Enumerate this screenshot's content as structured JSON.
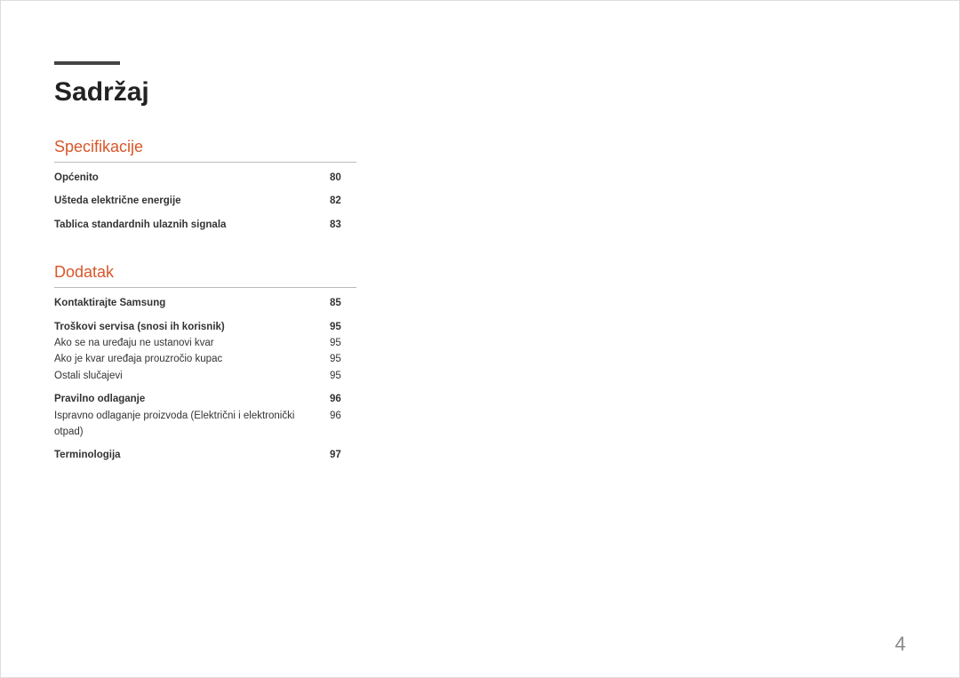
{
  "title": "Sadržaj",
  "page_number": "4",
  "sections": [
    {
      "heading": "Specifikacije",
      "groups": [
        [
          {
            "label": "Općenito",
            "page": "80",
            "bold": true
          }
        ],
        [
          {
            "label": "Ušteda električne energije",
            "page": "82",
            "bold": true
          }
        ],
        [
          {
            "label": "Tablica standardnih ulaznih signala",
            "page": "83",
            "bold": true
          }
        ]
      ]
    },
    {
      "heading": "Dodatak",
      "groups": [
        [
          {
            "label": "Kontaktirajte Samsung",
            "page": "85",
            "bold": true
          }
        ],
        [
          {
            "label": "Troškovi servisa (snosi ih korisnik)",
            "page": "95",
            "bold": true
          },
          {
            "label": "Ako se na uređaju ne ustanovi kvar",
            "page": "95",
            "bold": false
          },
          {
            "label": "Ako je kvar uređaja prouzročio kupac",
            "page": "95",
            "bold": false
          },
          {
            "label": "Ostali slučajevi",
            "page": "95",
            "bold": false
          }
        ],
        [
          {
            "label": "Pravilno odlaganje",
            "page": "96",
            "bold": true
          },
          {
            "label": "Ispravno odlaganje proizvoda (Električni i elektronički otpad)",
            "page": "96",
            "bold": false
          }
        ],
        [
          {
            "label": "Terminologija",
            "page": "97",
            "bold": true
          }
        ]
      ]
    }
  ]
}
